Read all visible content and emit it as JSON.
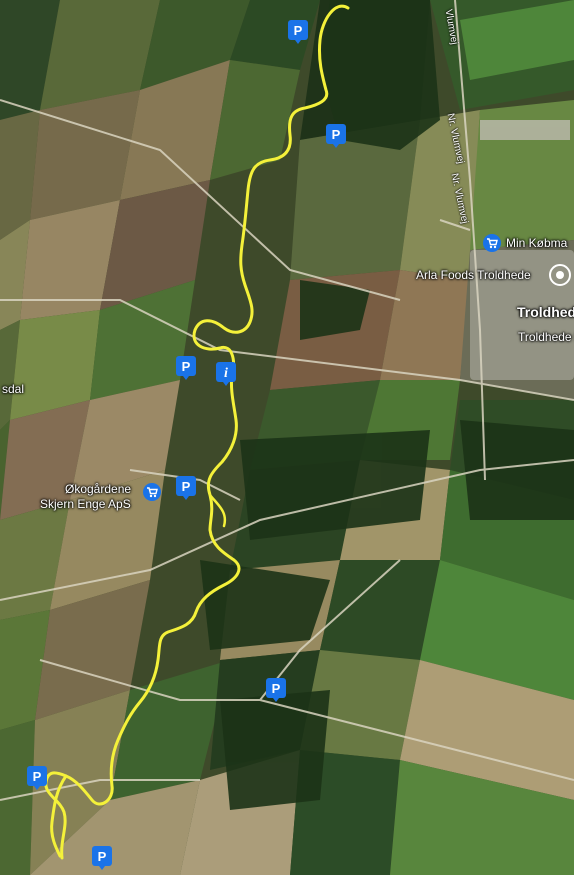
{
  "map": {
    "labels": {
      "place_troldhede": "Troldhede",
      "place_troldhede_k": "Troldhede K",
      "place_sdal": "sdal",
      "poi_min_kobmand": "Min Købma",
      "poi_arla": "Arla Foods Troldhede",
      "poi_okogardene_1": "Økogårdene",
      "poi_okogardene_2": "Skjern Enge ApS",
      "road_vlumvej_1": "Vlumvej",
      "road_vlumvej_2": "Nr. Vlumvej",
      "road_vlumvej_3": "Nr. Vlumvej"
    },
    "markers": {
      "parking_symbol": "P",
      "info_symbol": "i"
    },
    "colors": {
      "trail": "#f4f13a",
      "parking": "#1a73e8",
      "shop_poi": "#1a73e8",
      "forest": "#1f3a18",
      "field_light": "#8c9156"
    }
  }
}
